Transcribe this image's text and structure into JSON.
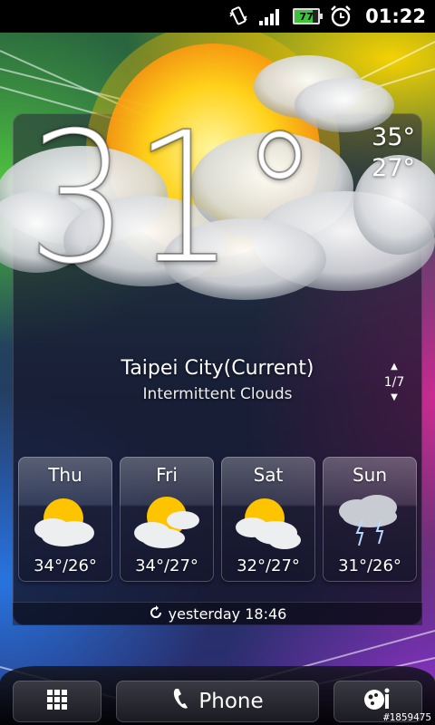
{
  "status_bar": {
    "icons": [
      "vibrate-icon",
      "signal-icon",
      "battery-icon",
      "alarm-icon"
    ],
    "battery_level": "77",
    "time": "01:22"
  },
  "weather": {
    "current_temp": "31°",
    "high": "35°",
    "low": "27°",
    "location": "Taipei City(Current)",
    "condition": "Intermittent Clouds",
    "page_indicator": "1/7",
    "last_updated": "yesterday 18:46"
  },
  "forecast": [
    {
      "day": "Thu",
      "temps": "34°/26°",
      "icon": "sun-cloud-icon"
    },
    {
      "day": "Fri",
      "temps": "34°/27°",
      "icon": "sun-cloud-icon"
    },
    {
      "day": "Sat",
      "temps": "32°/27°",
      "icon": "sun-cloud-icon"
    },
    {
      "day": "Sun",
      "temps": "31°/26°",
      "icon": "thunderstorm-icon"
    }
  ],
  "dock": {
    "phone_label": "Phone"
  },
  "watermark": "#1859475",
  "colors": {
    "battery_green": "#3ec23e",
    "sun_yellow": "#ffd21a"
  }
}
